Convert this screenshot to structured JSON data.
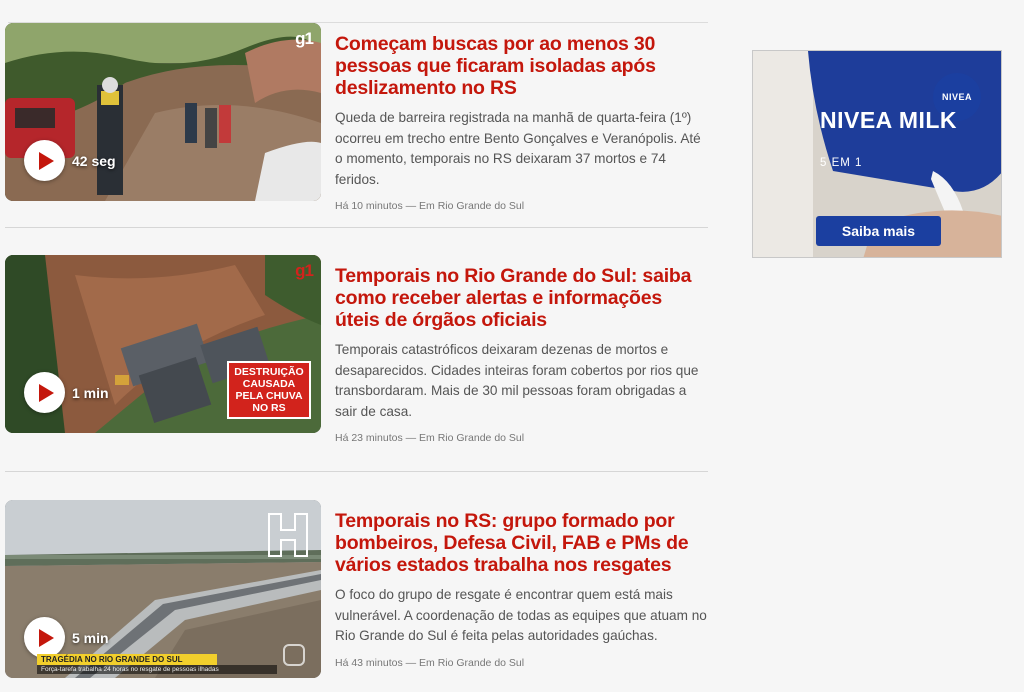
{
  "articles": [
    {
      "title": "Começam buscas por ao menos 30 pessoas que ficaram isoladas após deslizamento no RS",
      "summary": "Queda de barreira registrada na manhã de quarta-feira (1º) ocorreu em trecho entre Bento Gonçalves e Veranópolis. Até o momento, temporais no RS deixaram 37 mortos e 74 feridos.",
      "meta": "Há 10 minutos — Em Rio Grande do Sul",
      "duration": "42 seg",
      "logo": "g1"
    },
    {
      "title": "Temporais no Rio Grande do Sul: saiba como receber alertas e informações úteis de órgãos oficiais",
      "summary": "Temporais catastróficos deixaram dezenas de mortos e desaparecidos. Cidades inteiras foram cobertos por rios que transbordaram. Mais de 30 mil pessoas foram obrigadas a sair de casa.",
      "meta": "Há 23 minutos — Em Rio Grande do Sul",
      "duration": "1 min",
      "logo": "g1",
      "badge": "Destruição causada pela chuva no RS"
    },
    {
      "title": "Temporais no RS: grupo formado por bombeiros, Defesa Civil, FAB e PMs de vários estados trabalha nos resgates",
      "summary": "O foco do grupo de resgate é encontrar quem está mais vulnerável. A coordenação de todas as equipes que atuam no Rio Grande do Sul é feita pelas autoridades gaúchas.",
      "meta": "Há 43 minutos — Em Rio Grande do Sul",
      "duration": "5 min",
      "ticker_main": "TRAGÉDIA NO RIO GRANDE DO SUL",
      "ticker_sub": "Força-tarefa trabalha 24 horas no resgate de pessoas ilhadas"
    }
  ],
  "ad": {
    "brand_logo": "NIVEA",
    "title": "NIVEA MILK",
    "subtitle": "5 EM 1",
    "cta": "Saiba mais"
  },
  "colors": {
    "headline": "#c4170c",
    "background": "#f6f6f6",
    "nivea_blue": "#1b3fa0"
  }
}
